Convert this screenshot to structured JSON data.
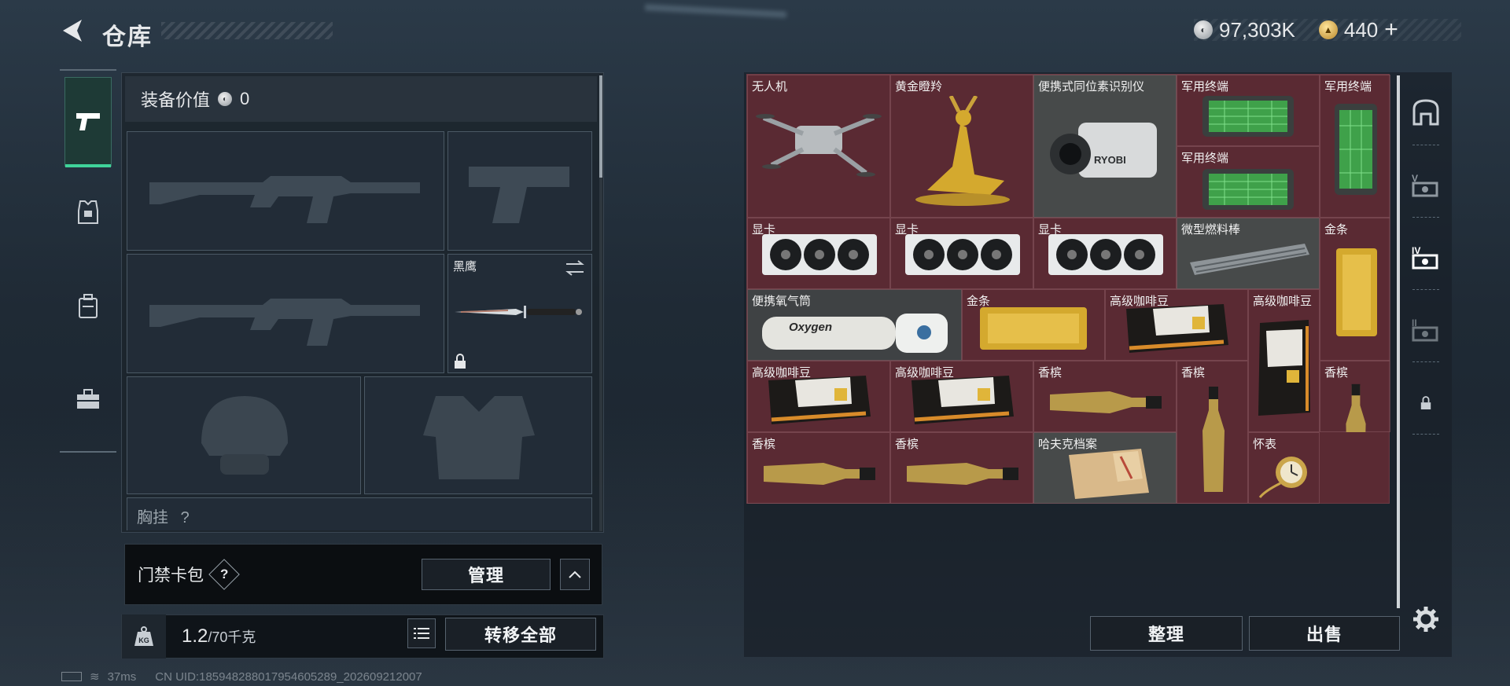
{
  "header": {
    "title": "仓库",
    "silver_amount": "97,303K",
    "gold_amount": "440",
    "gold_plus": "+"
  },
  "loadout": {
    "value_label": "装备价值",
    "value_amount": "0",
    "melee_name": "黑鹰",
    "next_section_label": "胸挂",
    "next_section_value": "?"
  },
  "keycard": {
    "label": "门禁卡包",
    "help": "?",
    "manage_label": "管理"
  },
  "capacity": {
    "current": "1.2",
    "max": "/70千克",
    "transfer_all_label": "转移全部"
  },
  "storage": {
    "sort_label": "整理",
    "sell_label": "出售",
    "items": [
      {
        "label": "无人机",
        "icon": "drone-icon"
      },
      {
        "label": "黄金瞪羚",
        "icon": "golden-gazelle-icon"
      },
      {
        "label": "便携式同位素识别仪",
        "icon": "isotope-detector-icon"
      },
      {
        "label": "军用终端",
        "icon": "military-terminal-icon"
      },
      {
        "label": "军用终端",
        "icon": "military-terminal-icon"
      },
      {
        "label": "军用终端",
        "icon": "military-terminal-icon"
      },
      {
        "label": "显卡",
        "icon": "graphics-card-icon"
      },
      {
        "label": "显卡",
        "icon": "graphics-card-icon"
      },
      {
        "label": "显卡",
        "icon": "graphics-card-icon"
      },
      {
        "label": "微型燃料棒",
        "icon": "fuel-rod-icon"
      },
      {
        "label": "金条",
        "icon": "gold-bar-icon"
      },
      {
        "label": "便携氧气筒",
        "icon": "oxygen-tank-icon"
      },
      {
        "label": "金条",
        "icon": "gold-bar-icon"
      },
      {
        "label": "高级咖啡豆",
        "icon": "coffee-bag-icon"
      },
      {
        "label": "高级咖啡豆",
        "icon": "coffee-bag-icon"
      },
      {
        "label": "高级咖啡豆",
        "icon": "coffee-bag-icon"
      },
      {
        "label": "高级咖啡豆",
        "icon": "coffee-bag-icon"
      },
      {
        "label": "香槟",
        "icon": "champagne-icon"
      },
      {
        "label": "香槟",
        "icon": "champagne-icon"
      },
      {
        "label": "香槟",
        "icon": "champagne-icon"
      },
      {
        "label": "香槟",
        "icon": "champagne-icon"
      },
      {
        "label": "香槟",
        "icon": "champagne-icon"
      },
      {
        "label": "哈夫克档案",
        "icon": "dossier-icon"
      },
      {
        "label": "怀表",
        "icon": "pocket-watch-icon"
      }
    ],
    "oxygen_text": "Oxygen",
    "detector_brand": "RYOBI"
  },
  "status": {
    "ping": "37ms",
    "uid": "CN UID:1859482880179546052​89_202609212007"
  },
  "colors": {
    "storage_bg": "#5a2a33",
    "active_tab": "#3fd39a",
    "gold": "#d4a92e"
  }
}
